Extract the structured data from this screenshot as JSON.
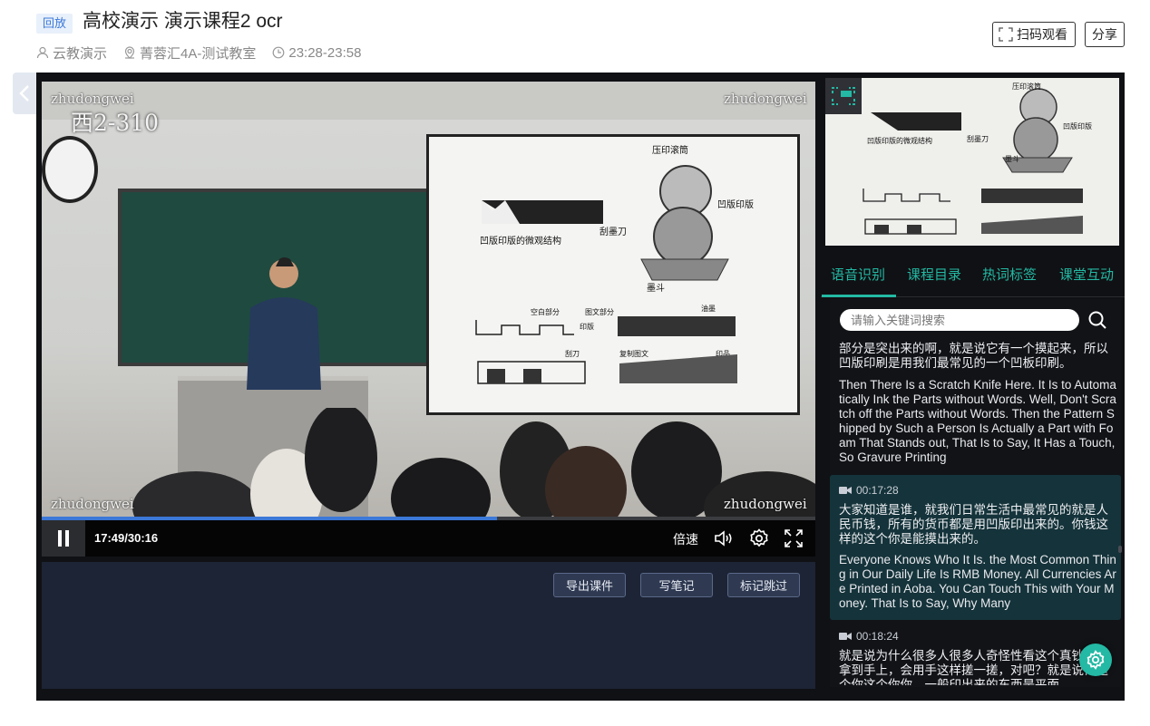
{
  "header": {
    "badge": "回放",
    "title": "高校演示 演示课程2 ocr",
    "teacher": "云教演示",
    "location": "菁蓉汇4A-测试教室",
    "time_range": "23:28-23:58",
    "scan_label": "扫码观看",
    "share_label": "分享"
  },
  "video": {
    "watermark": "zhudongwei",
    "room_label": "西2-310",
    "slide_labels": {
      "roller": "压印滚筒",
      "plate": "凹版印版",
      "micro": "凹版印版的微观结构",
      "doctor": "刮墨刀",
      "ink": "墨斗",
      "blank": "空白部分",
      "image": "图文部分",
      "printplate": "印版",
      "ink2": "油墨",
      "knife": "刮刀",
      "transfer": "复制图文",
      "print": "印品"
    }
  },
  "player": {
    "current_time": "17:49",
    "duration": "30:16",
    "time_text": "17:49/30:16",
    "progress": 0.589,
    "speed_label": "倍速"
  },
  "panel_buttons": {
    "export": "导出课件",
    "note": "写笔记",
    "mark": "标记跳过"
  },
  "tabs": [
    {
      "label": "语音识别",
      "active": true
    },
    {
      "label": "课程目录",
      "active": false
    },
    {
      "label": "热词标签",
      "active": false
    },
    {
      "label": "课堂互动",
      "active": false
    }
  ],
  "search": {
    "placeholder": "请输入关键词搜索"
  },
  "transcript": {
    "seg0_zh": "部分是突出来的啊，就是说它有一个摸起来，所以凹版印刷是用我们最常见的一个凹板印刷。",
    "seg0_en": "Then There Is a Scratch Knife Here. It Is to Automatically Ink the Parts without Words. Well, Don't Scratch off the Parts without Words. Then the Pattern Shipped by Such a Person Is Actually a Part with Foam That Stands out, That Is to Say, It Has a Touch, So Gravure Printing",
    "seg1_time": "00:17:28",
    "seg1_zh": "大家知道是谁，就我们日常生活中最常见的就是人民币钱，所有的货币都是用凹版印出来的。你钱这样的这个你是能摸出来的。",
    "seg1_en": "Everyone Knows Who It Is. the Most Common Thing in Our Daily Life Is RMB Money. All Currencies Are Printed in Aoba. You Can Touch This with Your Money. That Is to Say, Why Many",
    "seg2_time": "00:18:24",
    "seg2_zh": "就是说为什么很多人很多人奇怪性看这个真钞超会拿到手上，会用手这样搓一搓，对吧？就是说你这个你这个你你，一般印出来的东西是平面"
  },
  "colors": {
    "accent": "#23b9a4",
    "progress": "#3b78d8",
    "badge_bg": "#e8f0fb"
  }
}
